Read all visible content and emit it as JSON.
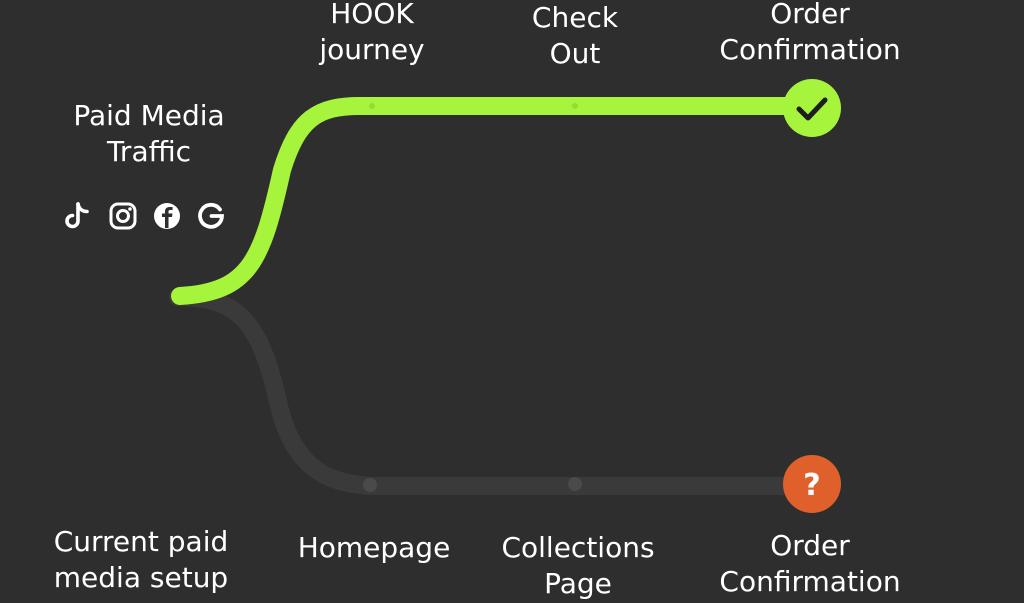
{
  "source": {
    "title_line1": "Paid Media",
    "title_line2": "Traffic",
    "icons": [
      "tiktok-icon",
      "instagram-icon",
      "facebook-icon",
      "google-icon"
    ]
  },
  "hook_path": {
    "step1_line1": "HOOK",
    "step1_line2": "journey",
    "step2_line1": "Check",
    "step2_line2": "Out",
    "end_line1": "Order",
    "end_line2": "Confirmation",
    "end_icon": "checkmark-icon",
    "color": "#a6f53c"
  },
  "current_path": {
    "title_line1": "Current paid",
    "title_line2": "media setup",
    "step1": "Homepage",
    "step2_line1": "Collections",
    "step2_line2": "Page",
    "end_line1": "Order",
    "end_line2": "Confirmation",
    "end_symbol": "?",
    "color": "#3a3a3a",
    "end_color": "#e0602c"
  },
  "colors": {
    "background": "#2e2e2e",
    "text": "#ffffff"
  }
}
